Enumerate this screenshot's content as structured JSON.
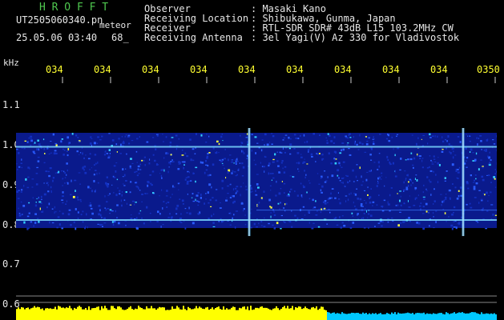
{
  "header": {
    "app_title": "H R O F F T",
    "filename": "UT2505060340.pn",
    "meteor_label": "meteor",
    "datetime": "25.05.06 03:40",
    "count": "68_"
  },
  "info": [
    {
      "label": "Observer",
      "value": ": Masaki Kano"
    },
    {
      "label": "Receiving Location",
      "value": ": Shibukawa, Gunma, Japan"
    },
    {
      "label": "Receiver",
      "value": ": RTL-SDR SDR# 43dB L15 103.2MHz CW"
    },
    {
      "label": "Receiving Antenna",
      "value": ": 3el Yagi(V) Az 330 for Vladivostok"
    }
  ],
  "chart_data": {
    "type": "heatmap",
    "ylabel": "kHz",
    "y_ticks": [
      "1.1",
      "1.0",
      "0.9",
      "0.8",
      "0.7",
      "0.6"
    ],
    "x_ticks": [
      "034",
      "034",
      "034",
      "034",
      "034",
      "034",
      "034",
      "034",
      "034",
      "0350"
    ],
    "ylim": [
      0.6,
      1.15
    ],
    "band_kHz": [
      0.81,
      1.0
    ],
    "carrier_lines_kHz": [
      0.995,
      0.81
    ],
    "faint_line_kHz": 0.835,
    "vertical_echo_minutes_fraction": [
      0.485,
      0.93
    ],
    "colors": {
      "background": "#000000",
      "signal": "#1e3cc8",
      "hot": "#ffff00",
      "level": "#00c8ff"
    }
  }
}
